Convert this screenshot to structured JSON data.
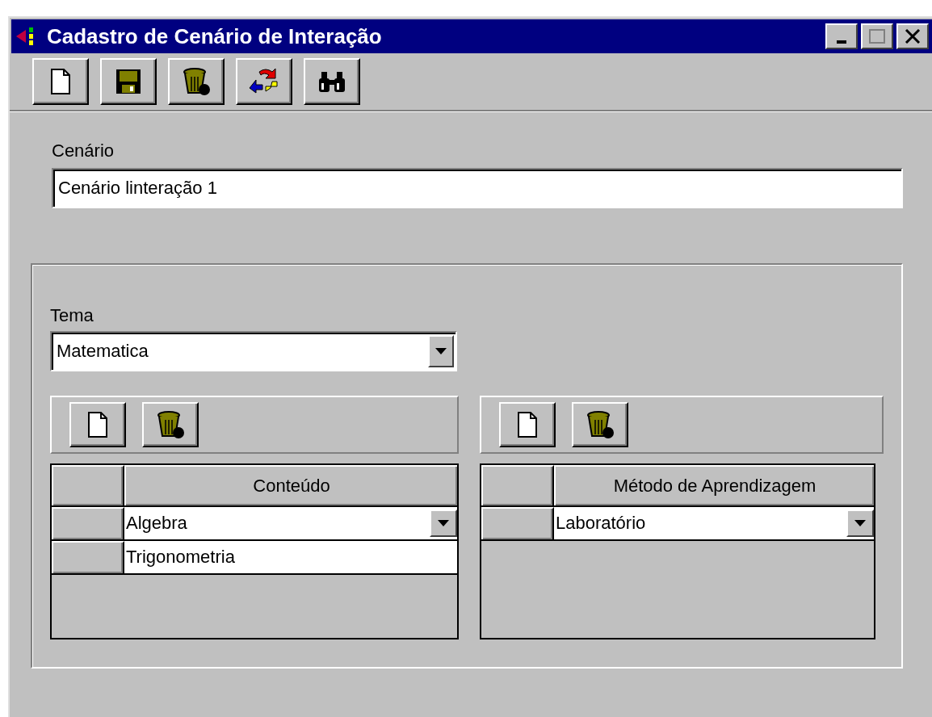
{
  "window": {
    "title": "Cadastro de Cenário de Interação"
  },
  "toolbar": [
    {
      "kind": "new"
    },
    {
      "kind": "save"
    },
    {
      "kind": "delete"
    },
    {
      "kind": "refresh"
    },
    {
      "kind": "find"
    }
  ],
  "scenario": {
    "label": "Cenário",
    "value": "Cenário linteração 1"
  },
  "theme": {
    "label": "Tema",
    "value": "Matematica"
  },
  "panels": [
    {
      "toolbar": [
        {
          "kind": "new"
        },
        {
          "kind": "delete"
        }
      ],
      "column": "Conteúdo",
      "rows": [
        {
          "value": "Algebra",
          "editing": true
        },
        {
          "value": "Trigonometria",
          "editing": false
        }
      ]
    },
    {
      "toolbar": [
        {
          "kind": "new"
        },
        {
          "kind": "delete"
        }
      ],
      "column": "Método de Aprendizagem",
      "rows": [
        {
          "value": "Laboratório",
          "editing": true
        }
      ]
    }
  ]
}
